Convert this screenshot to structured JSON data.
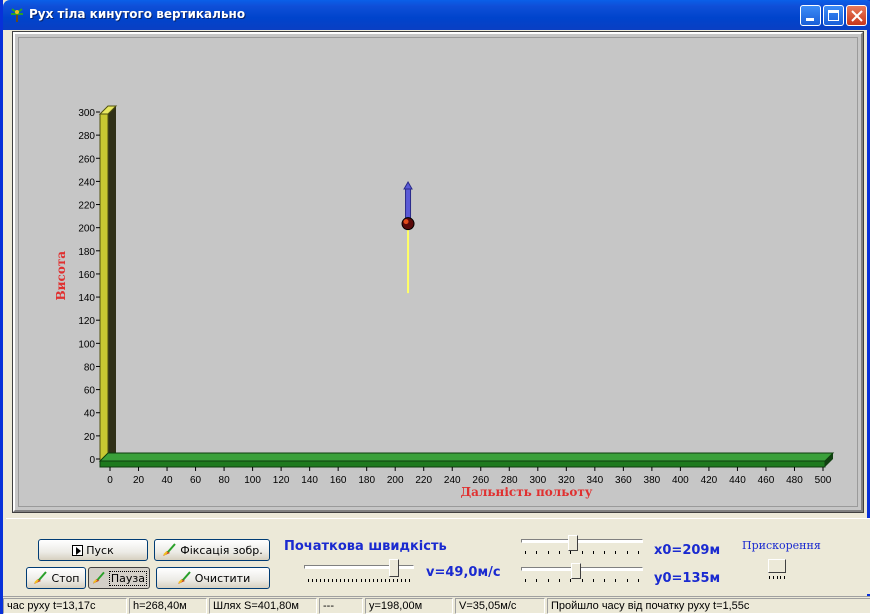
{
  "window": {
    "title": "Рух тіла кинутого вертикально",
    "title_color": "#0a5fe8"
  },
  "chart_data": {
    "type": "scatter",
    "xlabel": "Дальність польоту",
    "ylabel": "Висота",
    "xlim": [
      0,
      500
    ],
    "ylim": [
      0,
      300
    ],
    "x_ticks": [
      0,
      20,
      40,
      60,
      80,
      100,
      120,
      140,
      160,
      180,
      200,
      220,
      240,
      260,
      280,
      300,
      320,
      340,
      360,
      380,
      400,
      420,
      440,
      460,
      480,
      500
    ],
    "y_ticks": [
      0,
      20,
      40,
      60,
      80,
      100,
      120,
      140,
      160,
      180,
      200,
      220,
      240,
      260,
      280,
      300
    ],
    "body": {
      "x": 209,
      "y": 200
    },
    "trail": {
      "x": 209,
      "y_from": 140,
      "y_to": 200,
      "color": "#ffff66"
    },
    "velocity_vector": {
      "x": 209,
      "y_from": 200,
      "y_to": 236,
      "color": "#5a5ad6"
    },
    "axis_label_color": "#e03030",
    "wall_color": "#c8c832",
    "floor_color": "#1e7a1e",
    "background": "#c6c6c6"
  },
  "controls": {
    "start_label": "Пуск",
    "fix_label": "Фіксація зобр.",
    "stop_label": "Стоп",
    "pause_label": "Пауза",
    "clear_label": "Очистити",
    "initial_speed_label": "Початкова швидкість",
    "speed_value": "v=49,0м/с",
    "x0_value": "x0=209м",
    "y0_value": "y0=135м",
    "acceleration_label": "Прискорення",
    "speed_slider_fraction": 0.85,
    "x0_slider_fraction": 0.42,
    "y0_slider_fraction": 0.45
  },
  "statusbar": {
    "time": "час руху  t=13,17с",
    "height": "h=268,40м",
    "path": "Шлях S=401,80м",
    "dashes": "---",
    "y": "y=198,00м",
    "velocity": "V=35,05м/с",
    "elapsed": "Пройшло часу від початку руху  t=1,55с"
  }
}
